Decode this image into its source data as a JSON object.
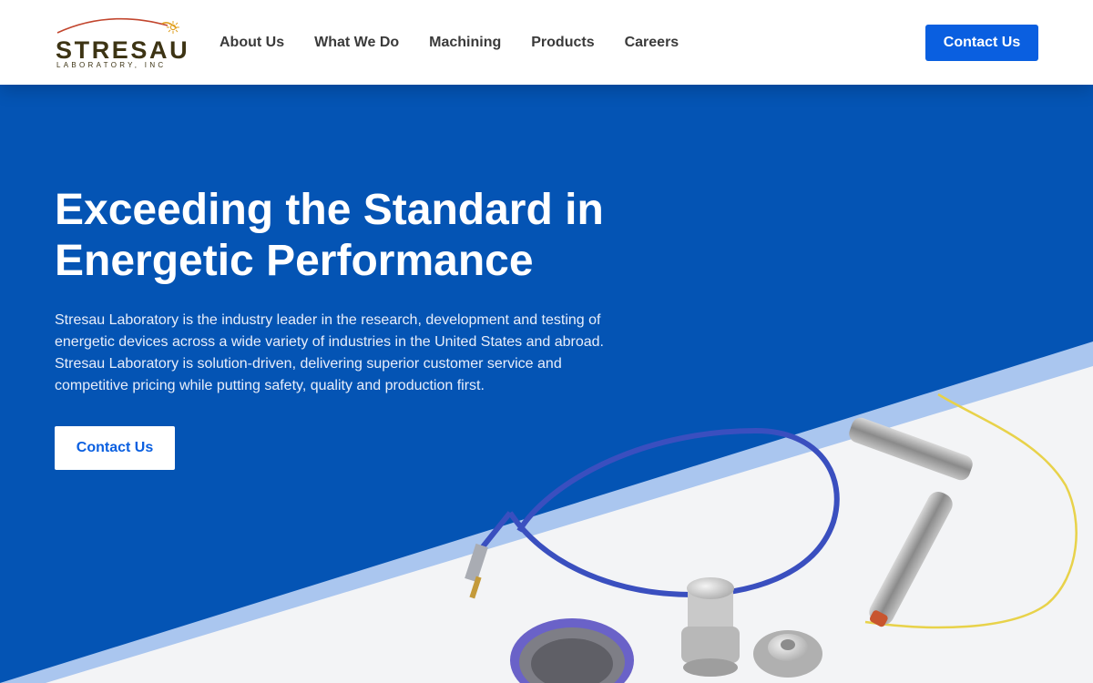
{
  "logo": {
    "name": "STRESAU",
    "tagline": "LABORATORY, INC"
  },
  "nav": {
    "items": [
      {
        "label": "About Us"
      },
      {
        "label": "What We Do"
      },
      {
        "label": "Machining"
      },
      {
        "label": "Products"
      },
      {
        "label": "Careers"
      }
    ]
  },
  "header": {
    "contact_label": "Contact Us"
  },
  "hero": {
    "title": "Exceeding the Standard in Energetic Performance",
    "description": "Stresau Laboratory is the industry leader in the research, development and testing of energetic devices across a wide variety of industries in the United States and abroad. Stresau Laboratory is solution-driven, delivering superior customer service and competitive pricing while putting safety, quality and production first.",
    "cta_label": "Contact Us"
  },
  "colors": {
    "brand_blue": "#0454b4",
    "button_blue": "#0a5fe0",
    "logo_text": "#3d3414",
    "logo_arc": "#c2462e",
    "logo_sun": "#e0a020"
  },
  "icons": [
    "sunburst-logo-icon"
  ]
}
